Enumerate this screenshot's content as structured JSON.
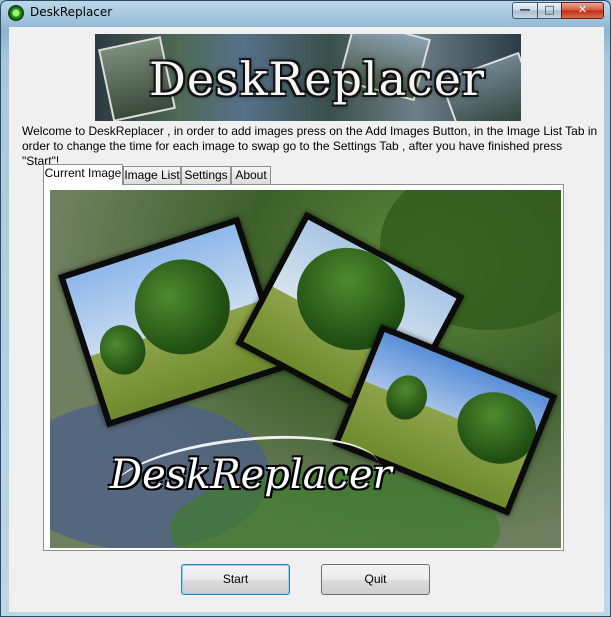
{
  "window": {
    "title": "DeskReplacer",
    "app_icon": "app-logo-icon"
  },
  "title_controls": {
    "minimize": "—",
    "maximize": "□",
    "close": "✕"
  },
  "banner": {
    "text": "DeskReplacer"
  },
  "welcome_text": "Welcome to DeskReplacer  , in order to add images press on the Add Images Button, in the Image List Tab in order to change the  time for each image to swap go to the Settings Tab , after you have finished press \"Start\"!",
  "tabs": [
    {
      "label": "Current Image",
      "active": true
    },
    {
      "label": "Image List",
      "active": false
    },
    {
      "label": "Settings",
      "active": false
    },
    {
      "label": "About",
      "active": false
    }
  ],
  "preview": {
    "logo_text": "DeskReplacer"
  },
  "buttons": {
    "start": "Start",
    "quit": "Quit"
  },
  "colors": {
    "accent": "#3c7fb1",
    "close": "#c02a10"
  }
}
